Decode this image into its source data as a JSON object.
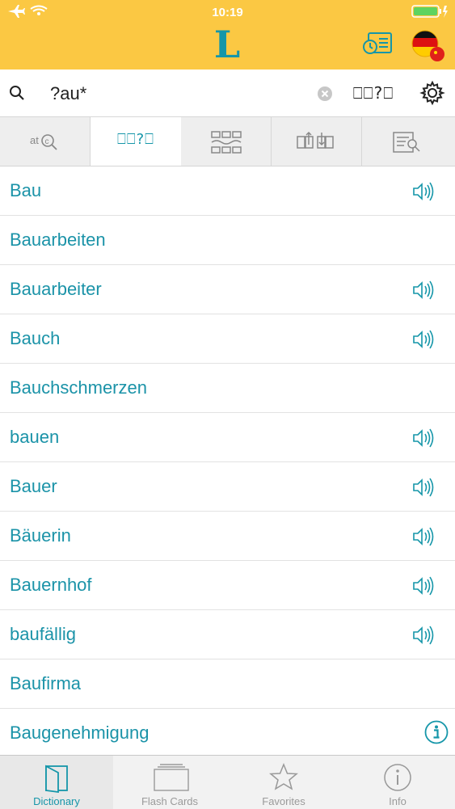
{
  "status_bar": {
    "time": "10:19"
  },
  "header": {
    "logo": "L"
  },
  "search": {
    "value": "?au*",
    "mode_label": "⎕⎕?⎕"
  },
  "tabs": [
    {
      "id": "autocomplete",
      "icon": "at-search-icon",
      "label": ""
    },
    {
      "id": "wildcard",
      "icon": "wildcard-icon",
      "label": "⎕⎕?⎕"
    },
    {
      "id": "fuzzy",
      "icon": "fuzzy-grid-icon",
      "label": ""
    },
    {
      "id": "inflection",
      "icon": "inflection-icon",
      "label": ""
    },
    {
      "id": "fulltext",
      "icon": "fulltext-search-icon",
      "label": ""
    }
  ],
  "results": [
    {
      "word": "Bau",
      "audio": true
    },
    {
      "word": "Bauarbeiten",
      "audio": false
    },
    {
      "word": "Bauarbeiter",
      "audio": true
    },
    {
      "word": "Bauch",
      "audio": true
    },
    {
      "word": "Bauchschmerzen",
      "audio": false
    },
    {
      "word": "bauen",
      "audio": true
    },
    {
      "word": "Bauer",
      "audio": true
    },
    {
      "word": "Bäuerin",
      "audio": true
    },
    {
      "word": "Bauernhof",
      "audio": true
    },
    {
      "word": "baufällig",
      "audio": true
    },
    {
      "word": "Baufirma",
      "audio": false
    },
    {
      "word": "Baugenehmigung",
      "audio": false,
      "info": true
    }
  ],
  "tabbar": {
    "dictionary": "Dictionary",
    "flashcards": "Flash Cards",
    "favorites": "Favorites",
    "info": "Info"
  },
  "colors": {
    "accent": "#1596a9",
    "header": "#fbc843"
  }
}
